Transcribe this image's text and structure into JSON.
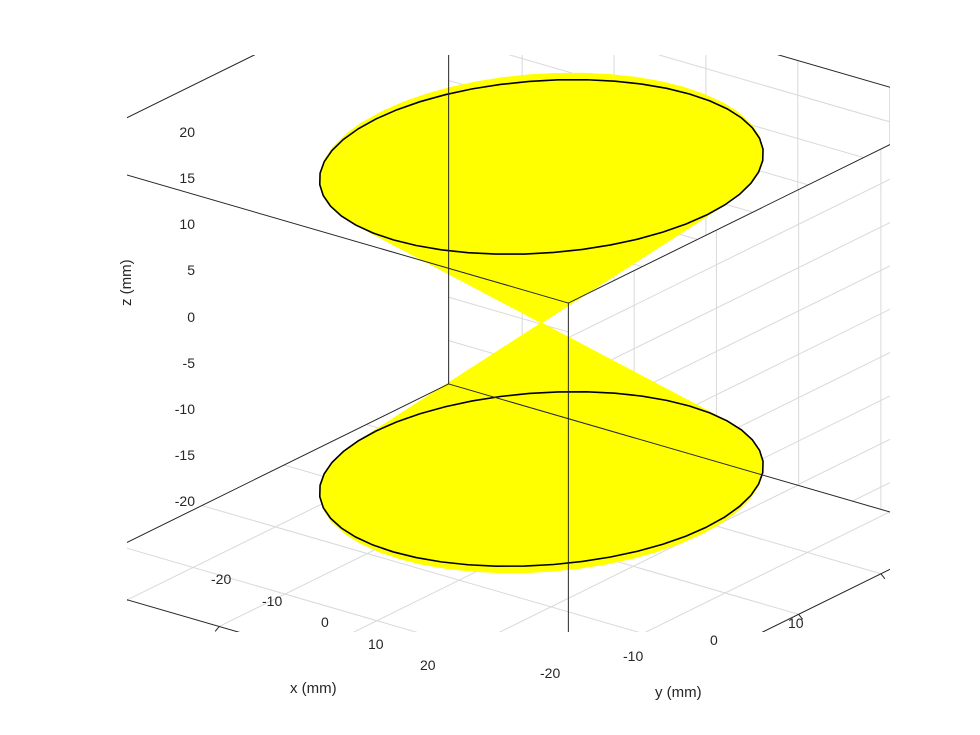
{
  "chart_data": {
    "type": "surface3d",
    "description": "3D MATLAB-style plot of a biconical antenna: two opposing cones with rounded caps, meeting at the origin.",
    "object_color": "#ffff00",
    "edge_color": "#000000",
    "x": {
      "label": "x (mm)",
      "ticks": [
        -20,
        -10,
        0,
        10,
        20
      ],
      "lim": [
        -28,
        28
      ]
    },
    "y": {
      "label": "y (mm)",
      "ticks": [
        -20,
        -10,
        0,
        10
      ],
      "lim": [
        -28,
        20
      ]
    },
    "z": {
      "label": "z (mm)",
      "ticks": [
        -20,
        -15,
        -10,
        -5,
        0,
        5,
        10,
        15,
        20
      ],
      "lim": [
        -25,
        24
      ]
    },
    "shape": {
      "cone_half_angle_deg": 45,
      "cone_base_radius_mm": 18,
      "cap": "spherical",
      "cap_radius_mm": 18,
      "overall_zmax_mm": 22,
      "overall_zmin_mm": -22,
      "symmetry": "top-bottom"
    },
    "grid": true,
    "view": {
      "azimuth_deg": -37.5,
      "elevation_deg": 30
    },
    "box": true
  },
  "z_ticks": {
    "t0": "-20",
    "t1": "-15",
    "t2": "-10",
    "t3": "-5",
    "t4": "0",
    "t5": "5",
    "t6": "10",
    "t7": "15",
    "t8": "20"
  },
  "x_ticks": {
    "t0": "-20",
    "t1": "-10",
    "t2": "0",
    "t3": "10",
    "t4": "20"
  },
  "y_ticks": {
    "t0": "-20",
    "t1": "-10",
    "t2": "0",
    "t3": "10"
  },
  "labels": {
    "x": "x (mm)",
    "y": "y (mm)",
    "z": "z (mm)"
  }
}
